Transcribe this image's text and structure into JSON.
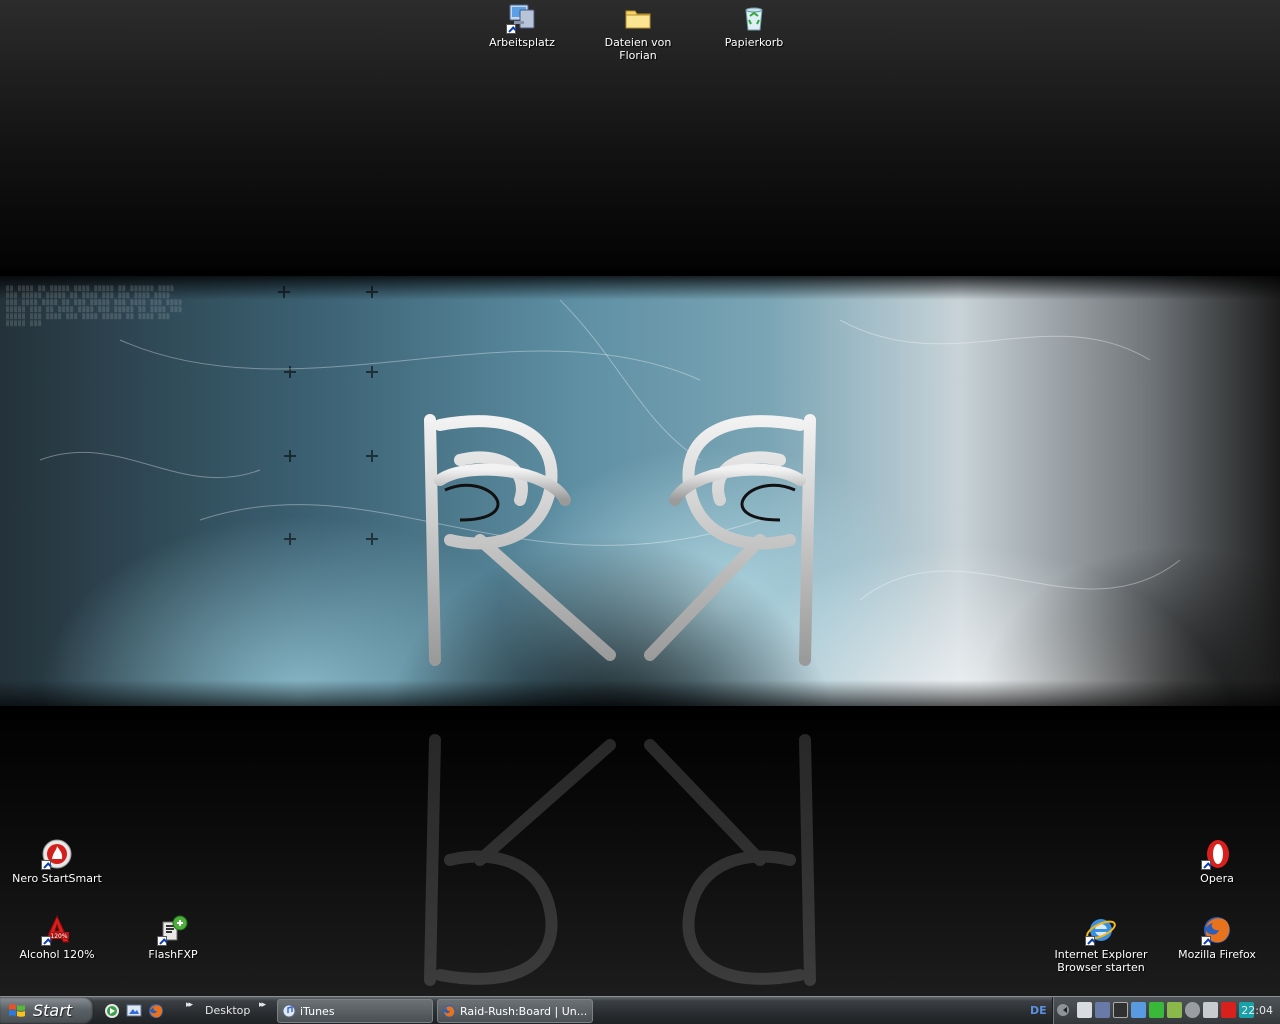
{
  "desktop": {
    "icons_top": [
      {
        "label": "Arbeitsplatz",
        "icon": "my-computer-icon"
      },
      {
        "label": "Dateien von Florian",
        "icon": "folder-icon"
      },
      {
        "label": "Papierkorb",
        "icon": "recycle-bin-icon"
      }
    ],
    "icons_bottom_left": [
      {
        "label": "Nero StartSmart",
        "icon": "nero-icon"
      },
      {
        "label": "Alcohol 120%",
        "icon": "alcohol-icon"
      },
      {
        "label": "FlashFXP",
        "icon": "flashfxp-icon"
      }
    ],
    "icons_bottom_right": [
      {
        "label": "Opera",
        "icon": "opera-icon"
      },
      {
        "label": "Internet Explorer\nBrowser starten",
        "icon": "internet-explorer-icon"
      },
      {
        "label": "Mozilla Firefox",
        "icon": "firefox-icon"
      }
    ]
  },
  "taskbar": {
    "start_label": "Start",
    "desktop_toolbar_label": "Desktop",
    "tasks": [
      {
        "label": "iTunes",
        "icon": "itunes-icon"
      },
      {
        "label": "Raid-Rush:Board | Un...",
        "icon": "firefox-icon"
      }
    ],
    "language": "DE",
    "clock": "22:04"
  },
  "colors": {
    "taskbar": "#3b3f43",
    "banner_accent": "#5e8fa3",
    "language_indicator": "#5d8fe0"
  }
}
